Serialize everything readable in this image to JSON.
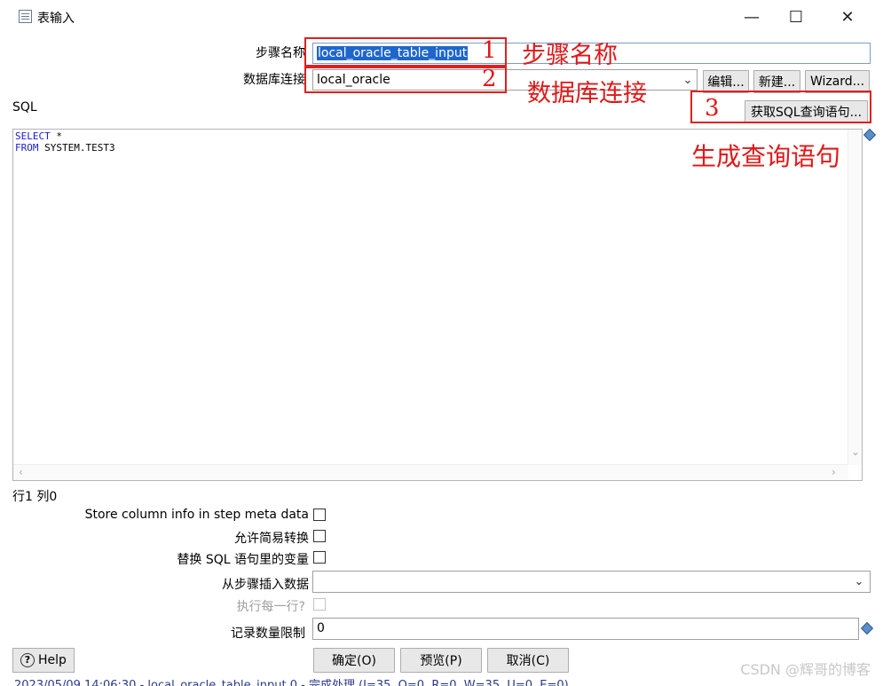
{
  "window": {
    "title": "表输入",
    "minimize_glyph": "—",
    "maximize_glyph": "☐",
    "close_glyph": "✕"
  },
  "step_name": {
    "label": "步骤名称",
    "value": "local_oracle_table_input"
  },
  "connection": {
    "label": "数据库连接",
    "value": "local_oracle",
    "edit_button": "编辑...",
    "new_button": "新建...",
    "wizard_button": "Wizard..."
  },
  "sql": {
    "label": "SQL",
    "get_sql_button": "获取SQL查询语句...",
    "lines": [
      {
        "keyword": "SELECT",
        "rest": " *"
      },
      {
        "keyword": "FROM",
        "rest": " SYSTEM.TEST3"
      }
    ],
    "cursor_position": "行1 列0"
  },
  "annotations": {
    "num1": "1",
    "num2": "2",
    "num3": "3",
    "text1": "步骤名称",
    "text2": "数据库连接",
    "text3": "生成查询语句",
    "color": "#e01818"
  },
  "options": {
    "store_column_info": {
      "label": "Store column info in step meta data",
      "checked": false
    },
    "lazy_conversion": {
      "label": "允许简易转换",
      "checked": false
    },
    "replace_variables": {
      "label": "替换 SQL 语句里的变量",
      "checked": false
    },
    "insert_from_step": {
      "label": "从步骤插入数据",
      "value": ""
    },
    "execute_each_row": {
      "label": "执行每一行?",
      "checked": false,
      "disabled": true
    },
    "limit": {
      "label": "记录数量限制",
      "value": "0"
    }
  },
  "buttons": {
    "help": "Help",
    "ok": "确定(O)",
    "preview": "预览(P)",
    "cancel": "取消(C)"
  },
  "icons": {
    "app": "table-input-icon",
    "help": "question-circle-icon",
    "variable": "variable-diamond-icon"
  },
  "watermark": "CSDN @辉哥的博客",
  "log_line": "2023/05/09 14:06:30 - local_oracle_table_input.0 - 完成处理 (I=35, O=0, R=0, W=35, U=0, E=0)"
}
